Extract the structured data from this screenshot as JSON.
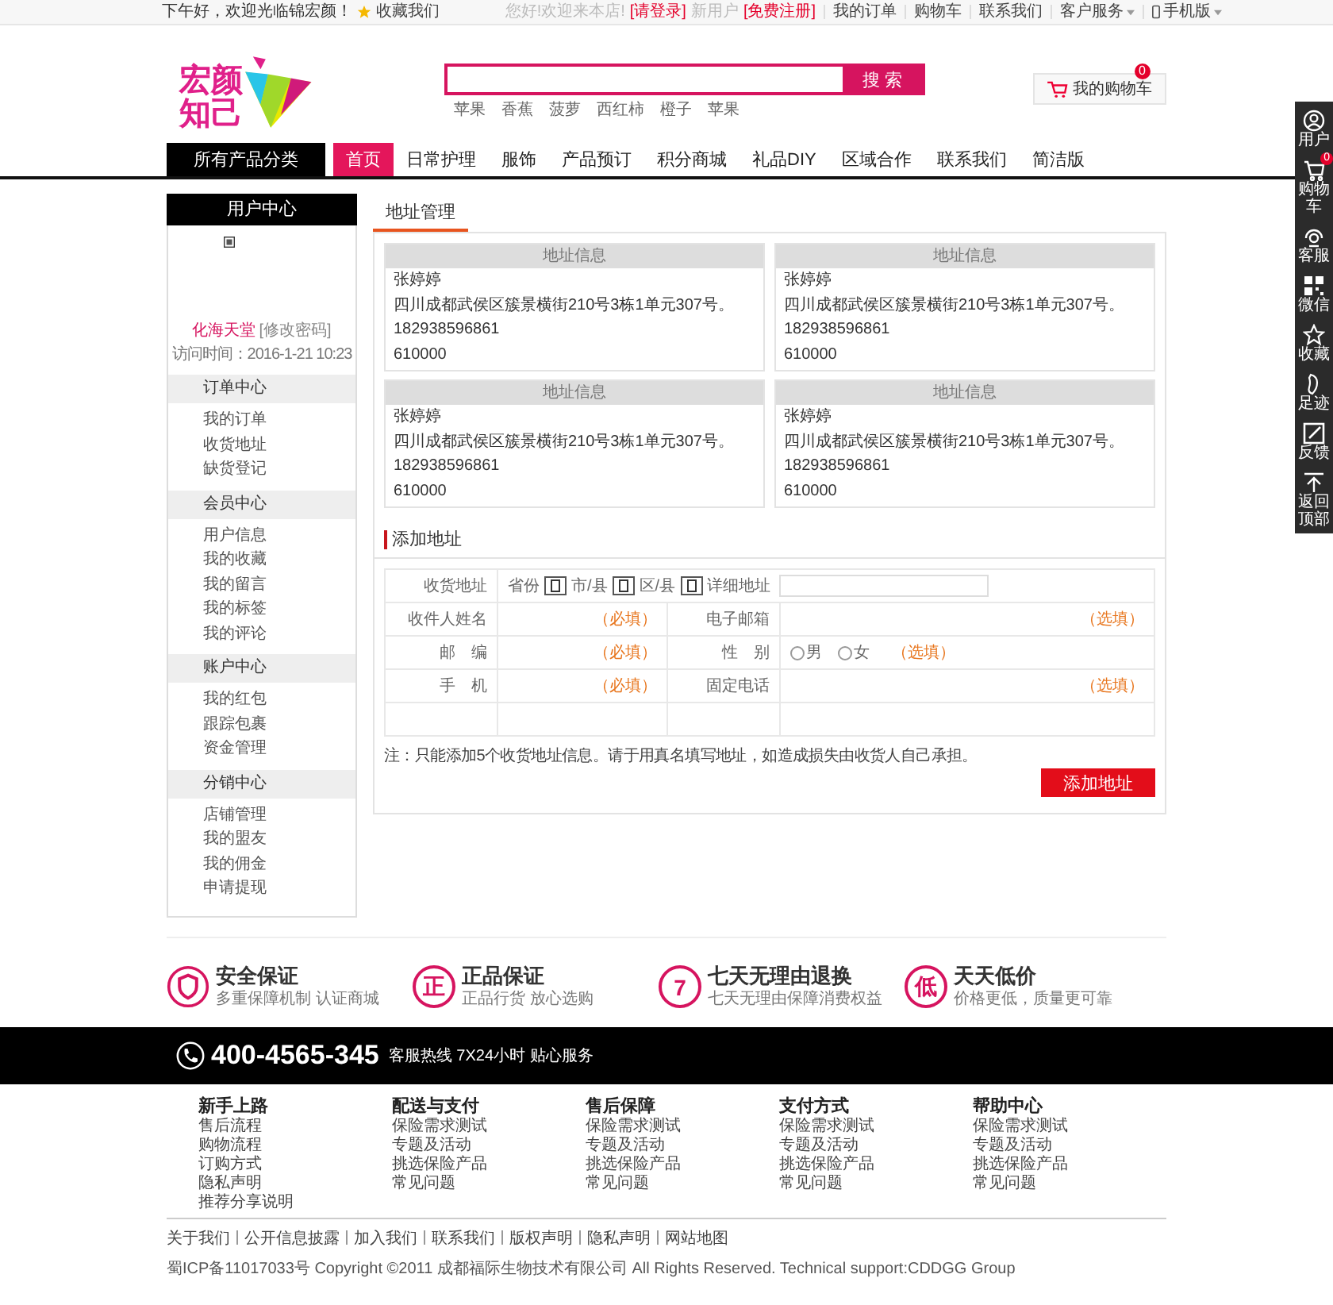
{
  "top_bar": {
    "greeting": "下午好，欢迎光临锦宏颜！",
    "favorite": "收藏我们",
    "links": [
      {
        "text": "您好!欢迎来本店!",
        "kind": "muted"
      },
      {
        "text": "[请登录]",
        "kind": "red"
      },
      {
        "text": "新用户",
        "kind": "muted"
      },
      {
        "text": "[免费注册]",
        "kind": "red"
      },
      {
        "text": "我的订单",
        "kind": "normal"
      },
      {
        "text": "购物车",
        "kind": "normal"
      },
      {
        "text": "联系我们",
        "kind": "normal"
      },
      {
        "text": "客户服务",
        "kind": "menu"
      },
      {
        "text": "手机版",
        "kind": "mobile"
      }
    ]
  },
  "header": {
    "logo": "宏颜知己",
    "search_button": "搜 索",
    "hot_words": [
      "苹果",
      "香蕉",
      "菠萝",
      "西红柿",
      "橙子",
      "苹果"
    ],
    "cart": {
      "label": "我的购物车",
      "count": "0"
    }
  },
  "nav": {
    "category": "所有产品分类",
    "items": [
      {
        "label": "首页",
        "selected": true
      },
      {
        "label": "日常护理",
        "selected": false
      },
      {
        "label": "服饰",
        "selected": false
      },
      {
        "label": "产品预订",
        "selected": false
      },
      {
        "label": "积分商城",
        "selected": false
      },
      {
        "label": "礼品DIY",
        "selected": false
      },
      {
        "label": "区域合作",
        "selected": false
      },
      {
        "label": "联系我们",
        "selected": false
      },
      {
        "label": "简洁版",
        "selected": false
      }
    ]
  },
  "toolbar": [
    {
      "label": "用户"
    },
    {
      "label": "购物车",
      "badge": "0"
    },
    {
      "label": "客服"
    },
    {
      "label": "微信"
    },
    {
      "label": "收藏"
    },
    {
      "label": "足迹"
    },
    {
      "label": "反馈"
    },
    {
      "label": "返回顶部"
    }
  ],
  "sidebar": {
    "title": "用户中心",
    "user": "化海天堂",
    "change_password": "[修改密码]",
    "visit_time": "访问时间：2016-1-21 10:23",
    "sections": [
      {
        "title": "订单中心",
        "items": [
          "我的订单",
          "收货地址",
          "缺货登记"
        ]
      },
      {
        "title": "会员中心",
        "items": [
          "用户信息",
          "我的收藏",
          "我的留言",
          "我的标签",
          "我的评论"
        ]
      },
      {
        "title": "账户中心",
        "items": [
          "我的红包",
          "跟踪包裹",
          "资金管理"
        ]
      },
      {
        "title": "分销中心",
        "items": [
          "店铺管理",
          "我的盟友",
          "我的佣金",
          "申请提现"
        ]
      }
    ]
  },
  "tabs": [
    {
      "label": "地址管理",
      "selected": true
    }
  ],
  "addresses": [
    {
      "header": "地址信息",
      "name": "张婷婷",
      "address": "四川成都武侯区簇景横街210号3栋1单元307号。",
      "phone": "182938596861",
      "zip": "610000"
    },
    {
      "header": "地址信息",
      "name": "张婷婷",
      "address": "四川成都武侯区簇景横街210号3栋1单元307号。",
      "phone": "182938596861",
      "zip": "610000"
    },
    {
      "header": "地址信息",
      "name": "张婷婷",
      "address": "四川成都武侯区簇景横街210号3栋1单元307号。",
      "phone": "182938596861",
      "zip": "610000"
    },
    {
      "header": "地址信息",
      "name": "张婷婷",
      "address": "四川成都武侯区簇景横街210号3栋1单元307号。",
      "phone": "182938596861",
      "zip": "610000"
    }
  ],
  "add_form": {
    "title": "添加地址",
    "address_label": "收货地址",
    "province": "省份",
    "city": "市/县",
    "district": "区/县",
    "detail": "详细地址",
    "rows": [
      {
        "label1": "收件人姓名",
        "hint1": "（必填）",
        "label2": "电子邮箱",
        "hint2": "（选填）"
      },
      {
        "label1": "邮　编",
        "hint1": "（必填）",
        "label2": "性　别",
        "hint2": "（选填）",
        "kind": "gender"
      },
      {
        "label1": "手　机",
        "hint1": "（必填）",
        "label2": "固定电话",
        "hint2": "（选填）"
      }
    ],
    "genders": [
      {
        "label": "男",
        "selected": false
      },
      {
        "label": "女",
        "selected": false
      }
    ],
    "note": "注：只能添加5个收货地址信息。请于用真名填写地址，如造成损失由收货人自己承担。",
    "submit": "添加地址"
  },
  "features": [
    {
      "title": "安全保证",
      "subtitle": "多重保障机制 认证商城"
    },
    {
      "badge": "正",
      "title": "正品保证",
      "subtitle": "正品行货 放心选购"
    },
    {
      "badge": "7",
      "title": "七天无理由退换",
      "subtitle": "七天无理由保障消费权益"
    },
    {
      "badge": "低",
      "title": "天天低价",
      "subtitle": "价格更低，质量更可靠"
    }
  ],
  "hotline": {
    "number": "400-4565-345",
    "text": "客服热线 7X24小时 贴心服务"
  },
  "footer_columns": [
    {
      "title": "新手上路",
      "links": [
        "售后流程",
        "购物流程",
        "订购方式",
        "隐私声明",
        "推荐分享说明"
      ]
    },
    {
      "title": "配送与支付",
      "links": [
        "保险需求测试",
        "专题及活动",
        "挑选保险产品",
        "常见问题"
      ]
    },
    {
      "title": "售后保障",
      "links": [
        "保险需求测试",
        "专题及活动",
        "挑选保险产品",
        "常见问题"
      ]
    },
    {
      "title": "支付方式",
      "links": [
        "保险需求测试",
        "专题及活动",
        "挑选保险产品",
        "常见问题"
      ]
    },
    {
      "title": "帮助中心",
      "links": [
        "保险需求测试",
        "专题及活动",
        "挑选保险产品",
        "常见问题"
      ]
    }
  ],
  "footer_links": [
    "关于我们",
    "公开信息披露",
    "加入我们",
    "联系我们",
    "版权声明",
    "隐私声明",
    "网站地图"
  ],
  "copyright": "蜀ICP备11017033号 Copyright ©2011 成都福际生物技术有限公司 All Rights Reserved. Technical support:CDDGG Group"
}
